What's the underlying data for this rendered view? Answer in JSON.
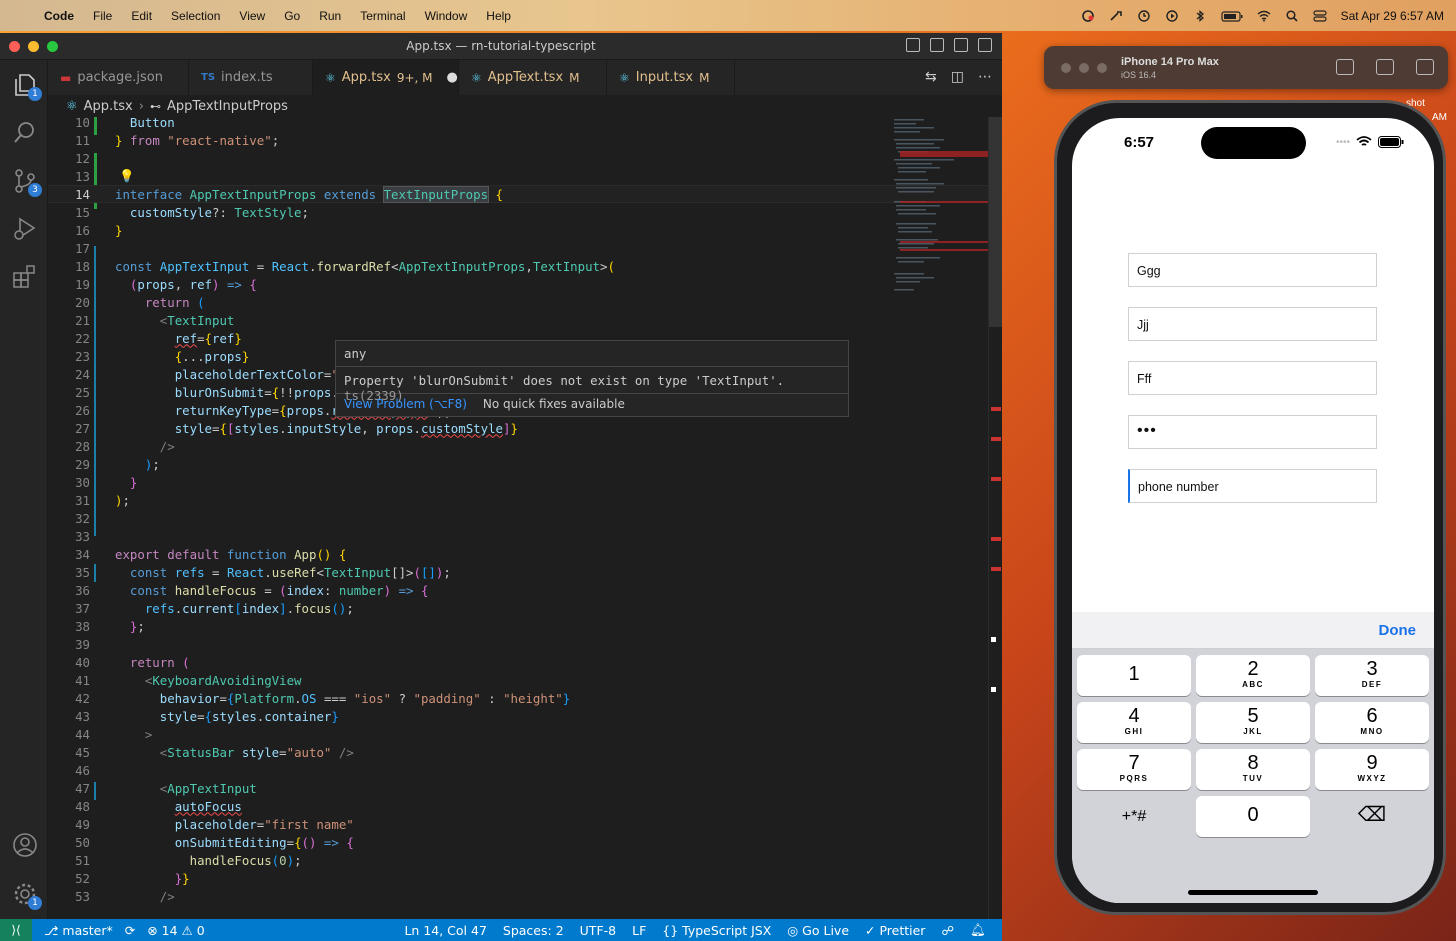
{
  "menubar": {
    "app_name": "Code",
    "items": [
      "File",
      "Edit",
      "Selection",
      "View",
      "Go",
      "Run",
      "Terminal",
      "Window",
      "Help"
    ],
    "datetime": "Sat Apr 29  6:57 AM"
  },
  "window": {
    "title": "App.tsx — rn-tutorial-typescript"
  },
  "activity": {
    "explorer_badge": "1",
    "scm_badge": "3",
    "settings_badge": "1"
  },
  "tabs": [
    {
      "icon": "package-icon",
      "label": "package.json",
      "mod": ""
    },
    {
      "icon": "ts-icon",
      "label": "index.ts",
      "mod": ""
    },
    {
      "icon": "react-icon",
      "label": "App.tsx",
      "mod": "9+, M"
    },
    {
      "icon": "react-icon",
      "label": "AppText.tsx",
      "mod": "M"
    },
    {
      "icon": "react-icon",
      "label": "Input.tsx",
      "mod": "M"
    }
  ],
  "breadcrumb": {
    "file": "App.tsx",
    "symbol": "AppTextInputProps"
  },
  "editor": {
    "line_numbers": [
      "10",
      "11",
      "12",
      "13",
      "14",
      "15",
      "16",
      "17",
      "18",
      "19",
      "20",
      "21",
      "22",
      "23",
      "24",
      "25",
      "26",
      "27",
      "28",
      "29",
      "30",
      "31",
      "32",
      "33",
      "34",
      "35",
      "36",
      "37",
      "38",
      "39",
      "40",
      "41",
      "42",
      "43",
      "44",
      "45",
      "46",
      "47",
      "48",
      "49",
      "50",
      "51",
      "52",
      "53"
    ]
  },
  "hover": {
    "type": "any",
    "message": "Property 'blurOnSubmit' does not exist on type 'TextInput'.",
    "code": "ts(2339)",
    "view_problem": "View Problem (⌥F8)",
    "no_fixes": "No quick fixes available"
  },
  "statusbar": {
    "branch": "master*",
    "errors": "14",
    "warnings": "0",
    "position": "Ln 14, Col 47",
    "spaces": "Spaces: 2",
    "encoding": "UTF-8",
    "eol": "LF",
    "language": "TypeScript JSX",
    "go_live": "Go Live",
    "prettier": "Prettier"
  },
  "simulator": {
    "device": "iPhone 14 Pro Max",
    "os": "iOS 16.4",
    "time": "6:57",
    "fields": [
      {
        "value": "Ggg"
      },
      {
        "value": "Jjj"
      },
      {
        "value": "Fff"
      },
      {
        "value": "•••"
      },
      {
        "value": "phone number"
      }
    ],
    "done_label": "Done",
    "keys": [
      {
        "d": "1",
        "l": ""
      },
      {
        "d": "2",
        "l": "ABC"
      },
      {
        "d": "3",
        "l": "DEF"
      },
      {
        "d": "4",
        "l": "GHI"
      },
      {
        "d": "5",
        "l": "JKL"
      },
      {
        "d": "6",
        "l": "MNO"
      },
      {
        "d": "7",
        "l": "PQRS"
      },
      {
        "d": "8",
        "l": "TUV"
      },
      {
        "d": "9",
        "l": "WXYZ"
      },
      {
        "d": "+*#",
        "l": ""
      },
      {
        "d": "0",
        "l": ""
      },
      {
        "d": "⌫",
        "l": ""
      }
    ]
  },
  "desktop": {
    "label1": "shot",
    "label2": "AM"
  }
}
